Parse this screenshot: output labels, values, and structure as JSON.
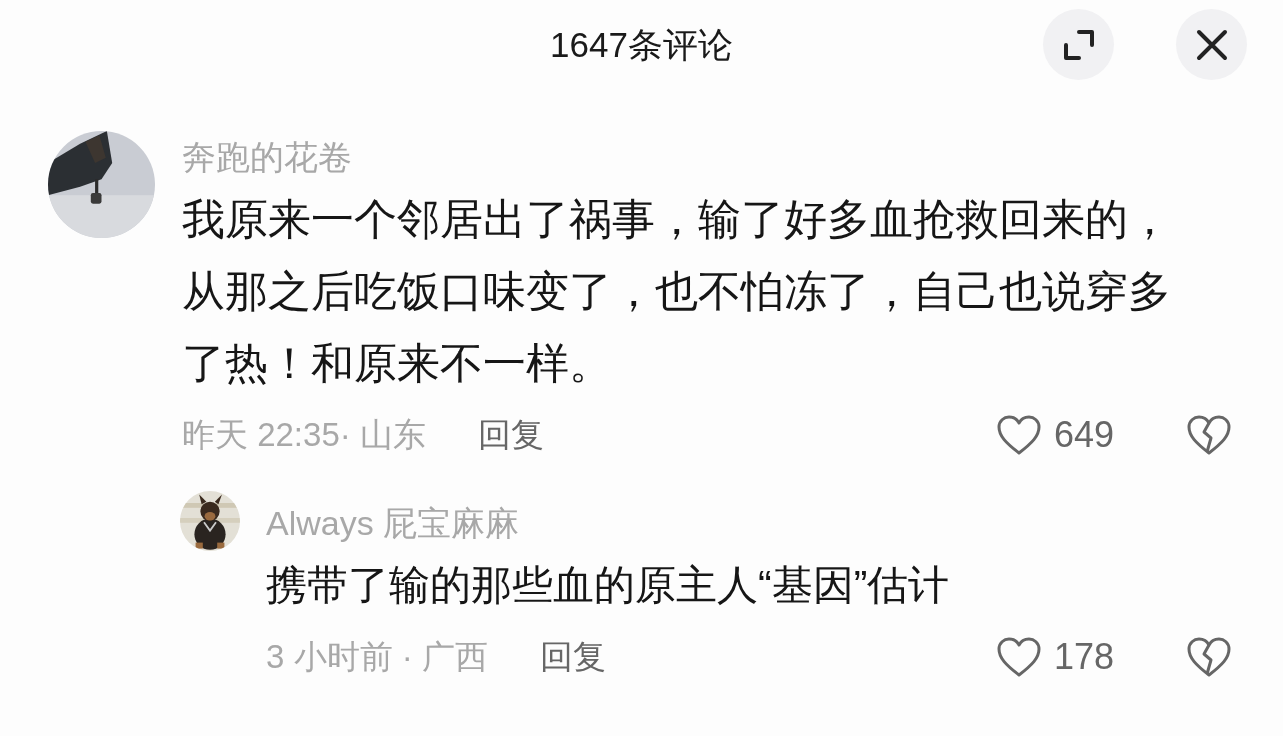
{
  "header": {
    "title": "1647条评论",
    "buttons": [
      {
        "kind": "expand"
      },
      {
        "kind": "close"
      }
    ]
  },
  "comments": [
    {
      "author": "奔跑的花卷",
      "text": "我原来一个邻居出了祸事，输了好多血抢救回来的，从那之后吃饭口味变了，也不怕冻了，自己也说穿多了热！和原来不一样。",
      "meta": "昨天 22:35· 山东",
      "reply_label": "回复",
      "likes": "649",
      "replies": [
        {
          "author": "Always 屁宝麻麻",
          "text": "携带了输的那些血的原主人“基因”估计",
          "meta": "3 小时前 · 广西",
          "reply_label": "回复",
          "likes": "178"
        }
      ]
    }
  ]
}
